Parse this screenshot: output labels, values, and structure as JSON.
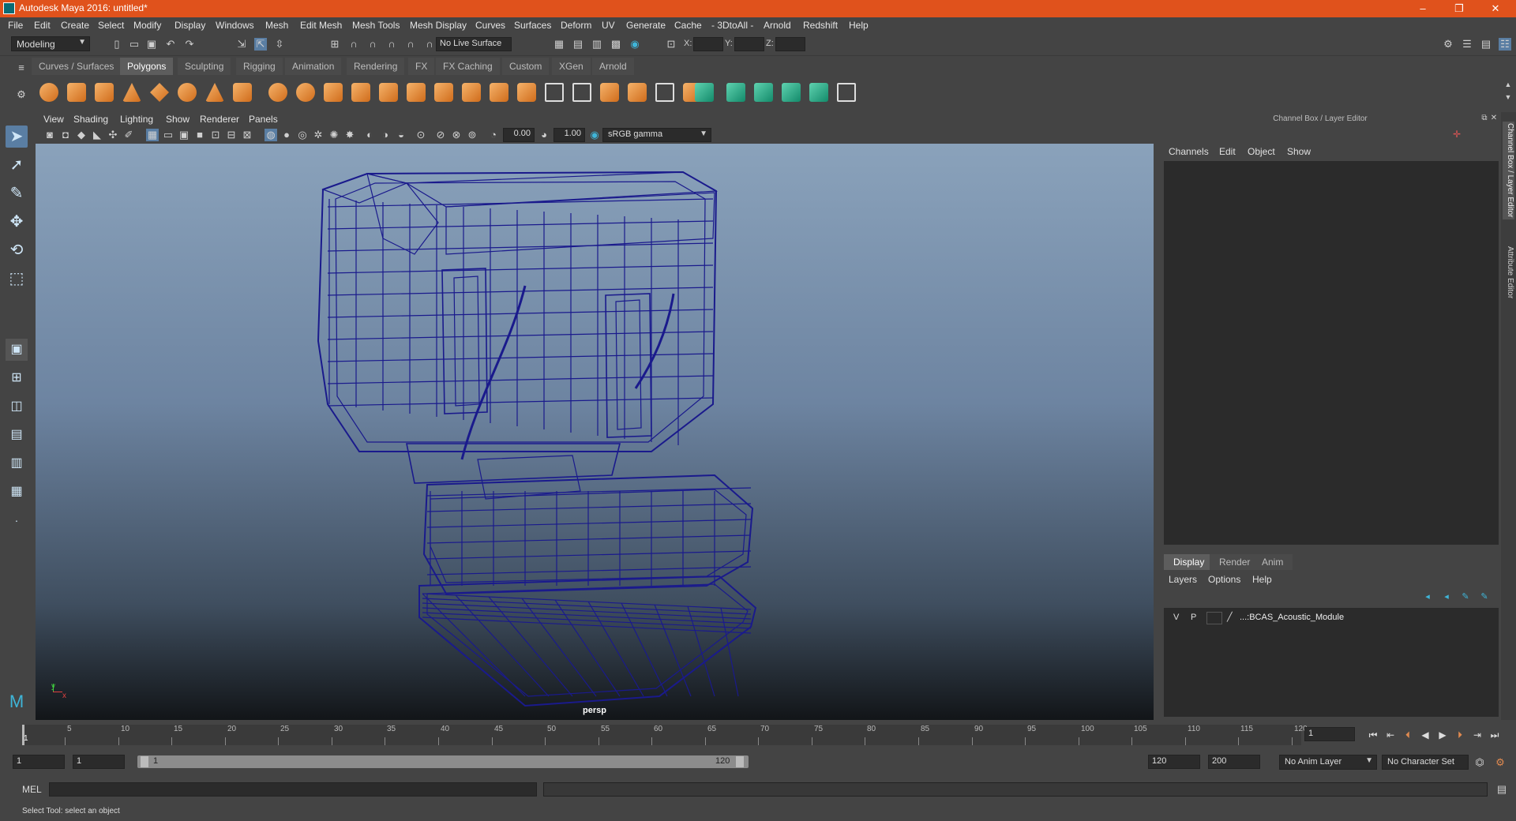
{
  "app": {
    "title": "Autodesk Maya 2016: untitled*",
    "window_controls": {
      "minimize": "–",
      "maximize": "❐",
      "close": "✕"
    }
  },
  "menubar": [
    "File",
    "Edit",
    "Create",
    "Select",
    "Modify",
    "Display",
    "Windows",
    "Mesh",
    "Edit Mesh",
    "Mesh Tools",
    "Mesh Display",
    "Curves",
    "Surfaces",
    "Deform",
    "UV",
    "Generate",
    "Cache",
    "- 3DtoAll -",
    "Arnold",
    "Redshift",
    "Help"
  ],
  "statusline": {
    "mode": "Modeling",
    "live_surface": "No Live Surface",
    "x_label": "X:",
    "y_label": "Y:",
    "z_label": "Z:"
  },
  "shelf": {
    "tabs": [
      "Curves / Surfaces",
      "Polygons",
      "Sculpting",
      "Rigging",
      "Animation",
      "Rendering",
      "FX",
      "FX Caching",
      "Custom",
      "XGen",
      "Arnold"
    ],
    "active_tab": "Polygons",
    "icons": [
      "sphere-icon",
      "cube-icon",
      "cylinder-icon",
      "cone-icon",
      "torus-icon",
      "ring-icon",
      "pyramid-icon",
      "pipe-icon",
      "combine-icon",
      "separate-icon",
      "extract-icon",
      "smooth-icon",
      "boolean-icon",
      "mirror-icon",
      "extrude-icon",
      "bridge-icon",
      "append-icon",
      "fill-hole-icon",
      "multicut-icon",
      "target-weld-icon",
      "bevel-icon",
      "chamfer-icon",
      "uv-planar-icon",
      "uv-cylindrical-icon",
      "uv-spherical-icon",
      "uv-automatic-icon",
      "uv-editor-icon",
      "transfer-icon",
      "checker-icon",
      "unfold-icon"
    ]
  },
  "viewport": {
    "menu": [
      "View",
      "Shading",
      "Lighting",
      "Show",
      "Renderer",
      "Panels"
    ],
    "exposure": "0.00",
    "gamma": "1.00",
    "color_space": "sRGB gamma",
    "camera": "persp",
    "axis_y": "y",
    "axis_x": "x",
    "wireframe_color": "#1a1a8c"
  },
  "channel_box": {
    "title": "Channel Box / Layer Editor",
    "menu": [
      "Channels",
      "Edit",
      "Object",
      "Show"
    ],
    "layer_tabs": [
      "Display",
      "Render",
      "Anim"
    ],
    "active_layer_tab": "Display",
    "layer_menu": [
      "Layers",
      "Options",
      "Help"
    ],
    "layers": [
      {
        "v": "V",
        "p": "P",
        "name": "...:BCAS_Acoustic_Module"
      }
    ]
  },
  "side_tabs": [
    "Channel Box / Layer Editor",
    "Attribute Editor"
  ],
  "timeline": {
    "ticks": [
      "1",
      "5",
      "10",
      "15",
      "20",
      "25",
      "30",
      "35",
      "40",
      "45",
      "50",
      "55",
      "60",
      "65",
      "70",
      "75",
      "80",
      "85",
      "90",
      "95",
      "100",
      "105",
      "110",
      "115",
      "120"
    ],
    "current_frame": "1",
    "end_label": "120"
  },
  "range": {
    "start": "1",
    "playback_start": "1",
    "range_start_label": "1",
    "range_end_label": "120",
    "playback_end": "120",
    "end": "200",
    "anim_layer": "No Anim Layer",
    "character_set": "No Character Set"
  },
  "cmdline": {
    "label": "MEL"
  },
  "helpline": {
    "text": "Select Tool: select an object"
  }
}
